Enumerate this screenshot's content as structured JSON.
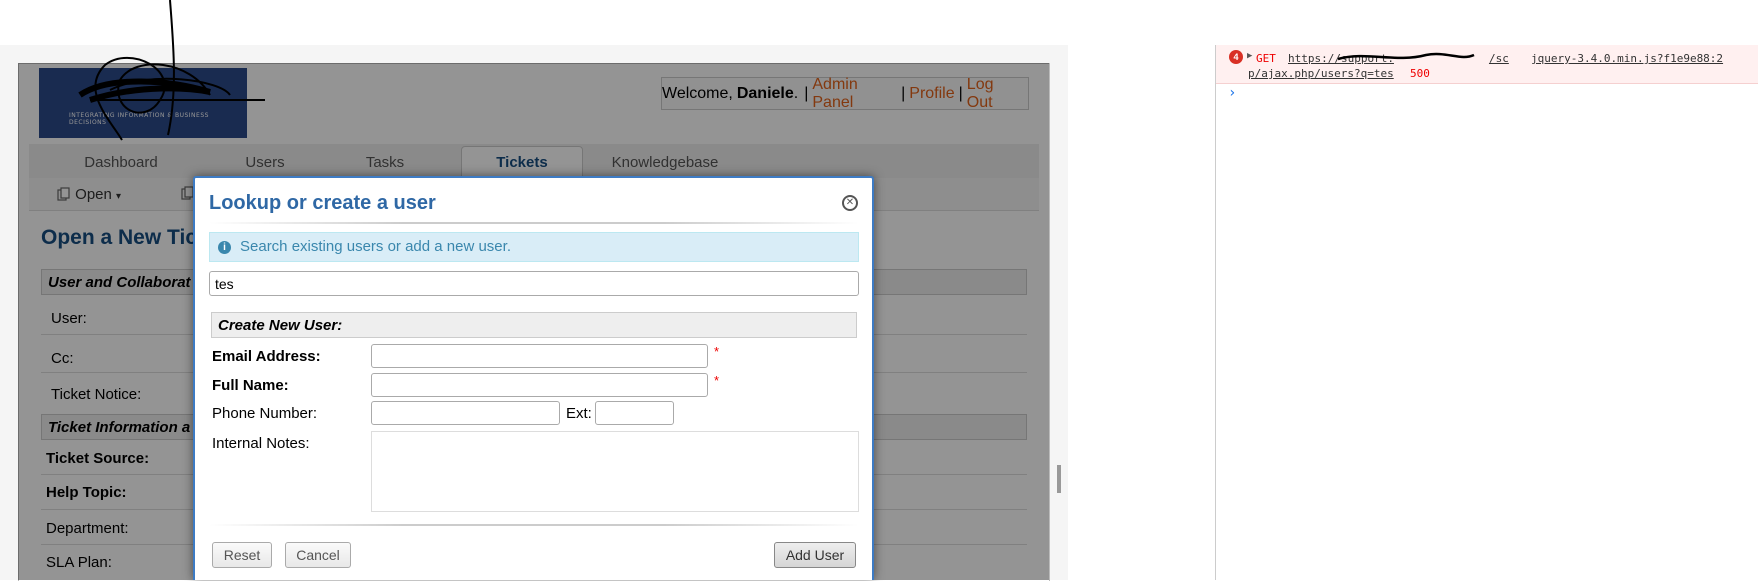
{
  "header": {
    "logo_tagline": "INTEGRATING INFORMATION & BUSINESS DECISIONS",
    "welcome_prefix": "Welcome,",
    "username": "Daniele",
    "username_suffix": ".",
    "admin_panel": "Admin Panel",
    "profile": "Profile",
    "logout": "Log Out",
    "sep": "|"
  },
  "nav": {
    "items": [
      "Dashboard",
      "Users",
      "Tasks",
      "Tickets",
      "Knowledgebase"
    ],
    "active": "Tickets"
  },
  "subnav": {
    "open_label": "Open",
    "open_caret": "▾"
  },
  "page": {
    "title": "Open a New Tic",
    "section1": "User and Collaborat",
    "user_label": "User:",
    "cc_label": "Cc:",
    "ticket_notice_label": "Ticket Notice:",
    "section2": "Ticket Information a",
    "ticket_source_label": "Ticket Source:",
    "help_topic_label": "Help Topic:",
    "department_label": "Department:",
    "sla_plan_label": "SLA Plan:"
  },
  "dialog": {
    "title": "Lookup or create a user",
    "close_glyph": "✕",
    "info_icon_glyph": "i",
    "info_text": "Search existing users or add a new user.",
    "search_value": "tes",
    "create_header": "Create New User:",
    "email_label": "Email Address:",
    "fullname_label": "Full Name:",
    "phone_label": "Phone Number:",
    "ext_label": "Ext:",
    "notes_label": "Internal Notes:",
    "required_mark": "*",
    "reset_btn": "Reset",
    "cancel_btn": "Cancel",
    "add_btn": "Add User"
  },
  "console": {
    "error_count": "4",
    "method": "GET",
    "url_part1": "https://support.",
    "url_part2": "/sc",
    "source": "jquery-3.4.0.min.js?f1e9e88:2",
    "url_line2": "p/ajax.php/users?q=tes",
    "status": "500",
    "prompt": "›"
  },
  "colors": {
    "accent_blue": "#2f68a5",
    "link_orange": "#e2621b",
    "info_bg": "#d9edf7",
    "error_red": "#d93025"
  }
}
